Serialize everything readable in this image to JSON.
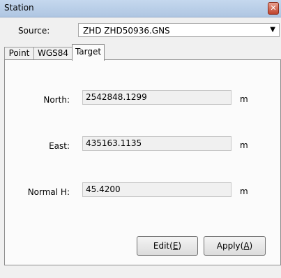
{
  "window": {
    "title": "Station",
    "close_icon": "close-icon"
  },
  "source": {
    "label": "Source:",
    "value": "ZHD ZHD50936.GNS"
  },
  "tabs": [
    {
      "label": "Point"
    },
    {
      "label": "WGS84"
    },
    {
      "label": "Target"
    }
  ],
  "active_tab": "Target",
  "fields": {
    "north": {
      "label": "North:",
      "value": "2542848.1299",
      "unit": "m"
    },
    "east": {
      "label": "East:",
      "value": "435163.1135",
      "unit": "m"
    },
    "height": {
      "label": "Normal H:",
      "value": "45.4200",
      "unit": "m"
    }
  },
  "buttons": {
    "edit": {
      "text": "Edit(",
      "mnemonic": "E",
      "suffix": ")"
    },
    "apply": {
      "text": "Apply(",
      "mnemonic": "A",
      "suffix": ")"
    }
  }
}
